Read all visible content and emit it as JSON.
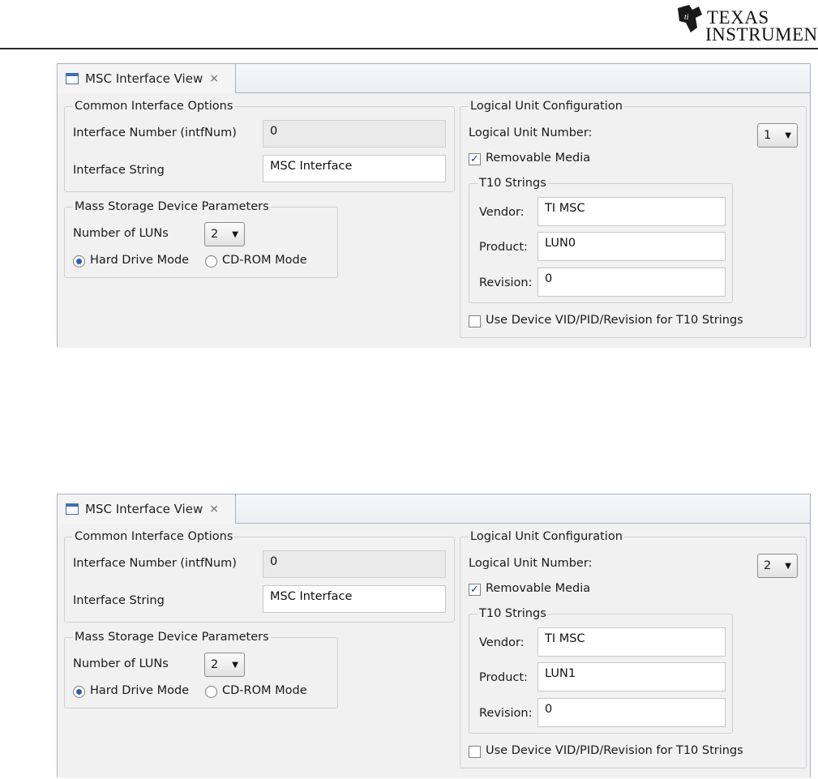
{
  "logo": {
    "line1": "TEXAS",
    "line2": "INSTRUMENTS"
  },
  "panels": [
    {
      "tab_label": "MSC Interface View",
      "common": {
        "title": "Common Interface Options",
        "intf_num_label": "Interface Number (intfNum)",
        "intf_num_value": "0",
        "intf_string_label": "Interface String",
        "intf_string_value": "MSC Interface"
      },
      "msd": {
        "title": "Mass Storage Device Parameters",
        "luns_label": "Number of LUNs",
        "luns_value": "2",
        "hard_drive_label": "Hard Drive Mode",
        "cdrom_label": "CD-ROM Mode"
      },
      "lu": {
        "title": "Logical Unit Configuration",
        "lun_label": "Logical Unit Number:",
        "lun_value": "1",
        "removable_label": "Removable Media",
        "t10_title": "T10 Strings",
        "vendor_label": "Vendor:",
        "vendor_value": "TI MSC",
        "product_label": "Product:",
        "product_value": "LUN0",
        "revision_label": "Revision:",
        "revision_value": "0",
        "use_vid_label": "Use Device VID/PID/Revision for T10 Strings"
      }
    },
    {
      "tab_label": "MSC Interface View",
      "common": {
        "title": "Common Interface Options",
        "intf_num_label": "Interface Number (intfNum)",
        "intf_num_value": "0",
        "intf_string_label": "Interface String",
        "intf_string_value": "MSC Interface"
      },
      "msd": {
        "title": "Mass Storage Device Parameters",
        "luns_label": "Number of LUNs",
        "luns_value": "2",
        "hard_drive_label": "Hard Drive Mode",
        "cdrom_label": "CD-ROM Mode"
      },
      "lu": {
        "title": "Logical Unit Configuration",
        "lun_label": "Logical Unit Number:",
        "lun_value": "2",
        "removable_label": "Removable Media",
        "t10_title": "T10 Strings",
        "vendor_label": "Vendor:",
        "vendor_value": "TI MSC",
        "product_label": "Product:",
        "product_value": "LUN1",
        "revision_label": "Revision:",
        "revision_value": "0",
        "use_vid_label": "Use Device VID/PID/Revision for T10 Strings"
      }
    }
  ],
  "state": {
    "hard_drive_selected": true,
    "removable_checked": true,
    "use_vid_checked": false
  },
  "icons": [
    "ti-logo-icon",
    "view-icon",
    "close-icon",
    "chevron-down-icon",
    "check-icon"
  ]
}
